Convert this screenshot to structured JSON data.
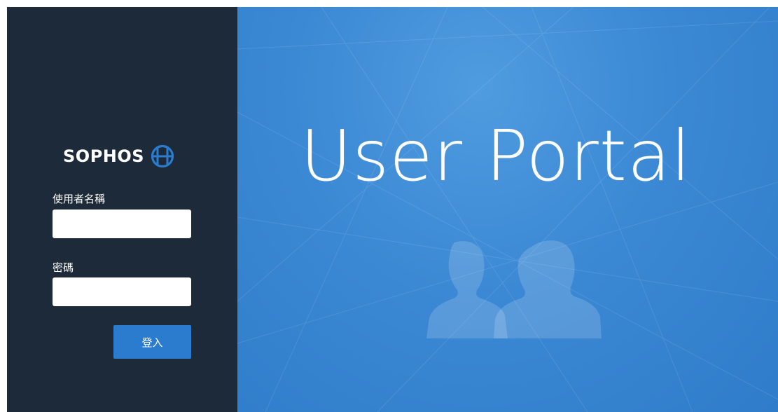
{
  "brand": {
    "name": "SOPHOS",
    "logo_icon": "globe-icon"
  },
  "login": {
    "username_label": "使用者名稱",
    "username_value": "",
    "password_label": "密碼",
    "password_value": "",
    "submit_label": "登入"
  },
  "hero": {
    "title": "User Portal",
    "illustration_icon": "users-icon"
  },
  "colors": {
    "sidebar_bg": "#1c2a3a",
    "hero_bg": "#3b88d4",
    "button_bg": "#2b7ccf",
    "text": "#ffffff"
  }
}
